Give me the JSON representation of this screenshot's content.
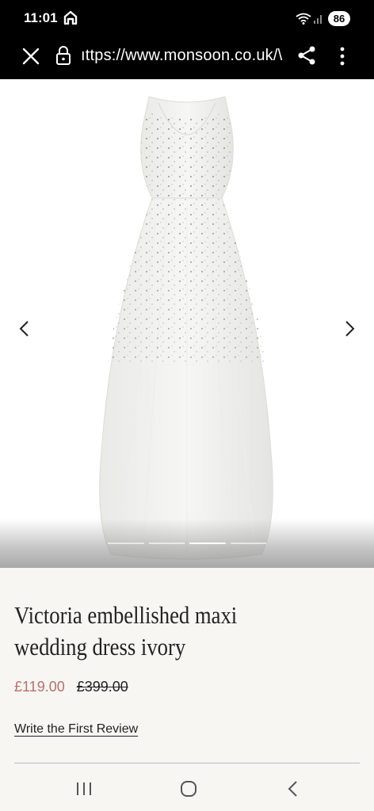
{
  "status_bar": {
    "time": "11:01",
    "battery": "86"
  },
  "browser": {
    "url": "ıttps://www.monsoon.co.uk/\\"
  },
  "product": {
    "title": "Victoria embellished maxi wedding dress ivory",
    "price": "£119.00",
    "was_price": "£399.00",
    "review_link": "Write the First Review"
  },
  "gallery": {
    "slide_count": 4,
    "active_slide": 3
  },
  "colors": {
    "sale_price": "#b7706b",
    "background": "#f8f6f2",
    "top_bar": "#000000"
  }
}
